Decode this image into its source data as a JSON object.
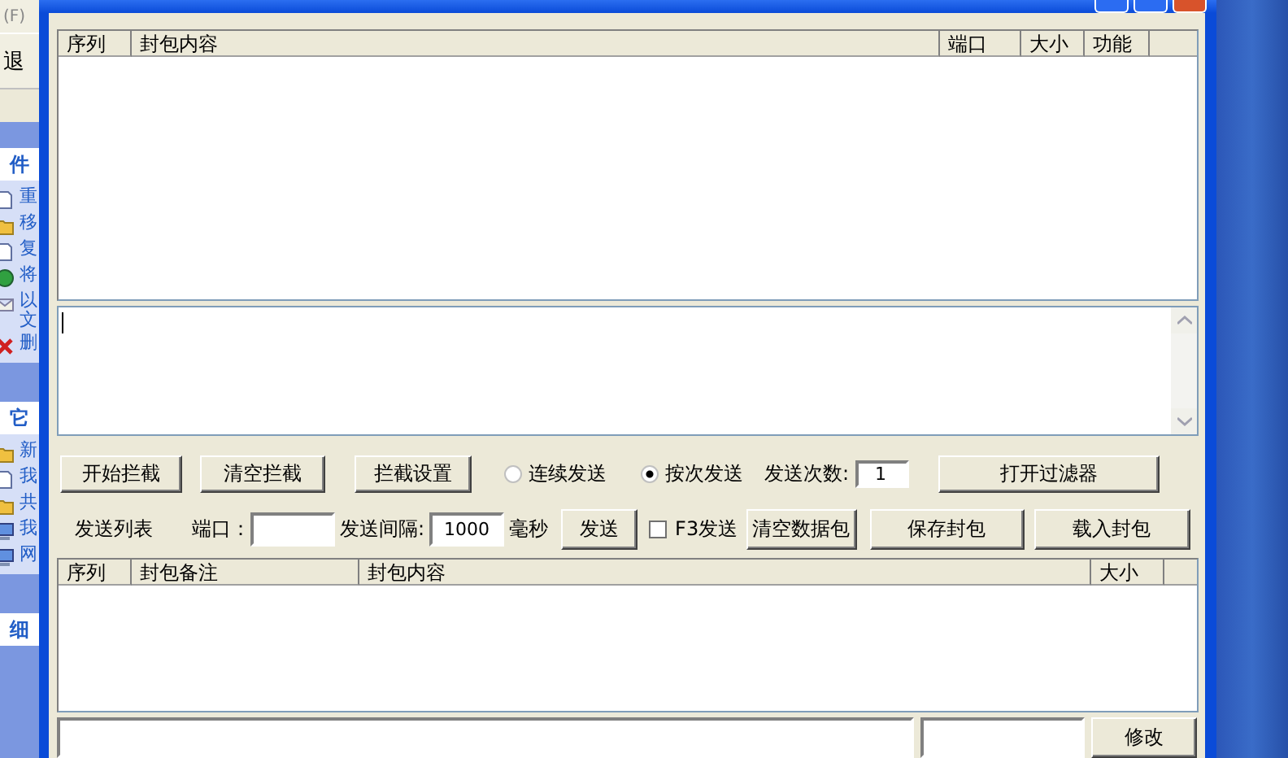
{
  "background_window": {
    "menu_fragment": "(F)",
    "back_button": "退",
    "sections": [
      {
        "title": "件",
        "items": [
          {
            "label": "重",
            "kind": "file"
          },
          {
            "label": "移",
            "kind": "folder"
          },
          {
            "label": "复",
            "kind": "file"
          },
          {
            "label": "将",
            "kind": "globe"
          },
          {
            "label": "以文",
            "kind": "mail"
          },
          {
            "label": "删",
            "kind": "delete"
          }
        ]
      },
      {
        "title": "它",
        "items": [
          {
            "label": "新",
            "kind": "folder"
          },
          {
            "label": "我",
            "kind": "file"
          },
          {
            "label": "共",
            "kind": "folder"
          },
          {
            "label": "我",
            "kind": "computer"
          },
          {
            "label": "网",
            "kind": "computer"
          }
        ]
      },
      {
        "title": "细"
      }
    ]
  },
  "capture_table": {
    "columns": [
      "序列",
      "封包内容",
      "端口",
      "大小",
      "功能"
    ]
  },
  "controls": {
    "buttons": [
      "开始拦截",
      "清空拦截",
      "拦截设置"
    ],
    "send_modes": [
      {
        "label": "连续发送",
        "selected": false
      },
      {
        "label": "按次发送",
        "selected": true
      }
    ],
    "send_count": {
      "label": "发送次数:",
      "value": "1"
    },
    "filter_button": "打开过滤器"
  },
  "send_row": {
    "list_label": "发送列表",
    "port": {
      "label": "端口："
    },
    "interval": {
      "label": "发送间隔:",
      "value": "1000"
    },
    "unit": "毫秒",
    "send_button": "发送",
    "f3_send": {
      "label": "F3发送",
      "checked": false
    },
    "buttons": [
      "清空数据包",
      "保存封包",
      "载入封包"
    ]
  },
  "send_table": {
    "columns": [
      "序列",
      "封包备注",
      "封包内容",
      "大小"
    ]
  },
  "edit_button": "修改"
}
